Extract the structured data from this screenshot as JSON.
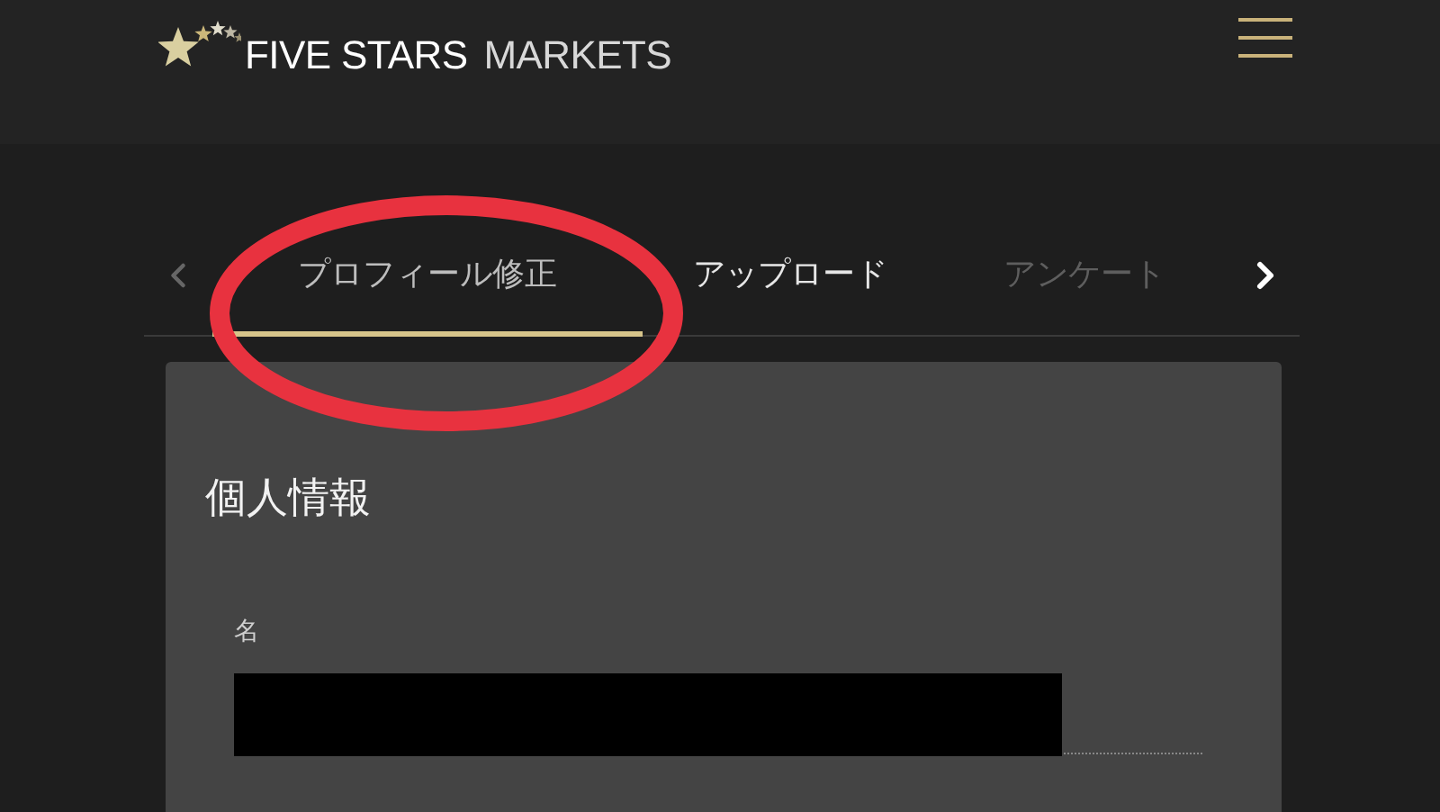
{
  "header": {
    "brand_primary": "FIVE STARS",
    "brand_secondary": "MARKETS"
  },
  "tabs_nav": {
    "prev_enabled": false,
    "next_enabled": true
  },
  "tabs": [
    {
      "label": "プロフィール修正",
      "selected": true,
      "disabled": false
    },
    {
      "label": "アップロード",
      "selected": false,
      "disabled": false
    },
    {
      "label": "アンケート",
      "selected": false,
      "disabled": true
    }
  ],
  "card": {
    "title": "個人情報",
    "fields": [
      {
        "label": "名",
        "value_redacted": true
      }
    ]
  },
  "annotation": {
    "kind": "ellipse",
    "color": "#e8323f"
  }
}
